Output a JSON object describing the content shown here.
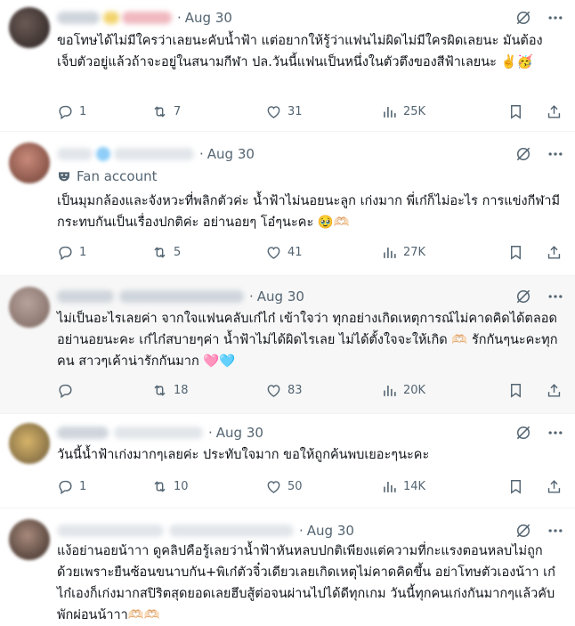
{
  "replies": [
    {
      "date": "Aug 30",
      "label": "",
      "text": "ขอโทษได้ไม่มีใครว่าเลยนะคับน้ำฟ้า แต่อยากให้รู้ว่าแฟนไม่ผิดไม่มีใครผิดเลยนะ มันต้องเจ็บตัวอยู่แล้วถ้าจะอยู่ในสนามกีฬา ปล.วันนี้แฟนเป็นหนึ่งในตัวตึงของสีฟ้าเลยนะ ✌️🥳",
      "stats": {
        "replies": "1",
        "reposts": "7",
        "likes": "31",
        "views": "25K"
      }
    },
    {
      "date": "Aug 30",
      "label": "Fan account",
      "text": "เป็นมุมกล้องและจังหวะที่พลิกตัวค่ะ น้ำฟ้าไม่นอยนะลูก เก่งมาก พี่เก๋ก็ไม่อะไร การแข่งกีฬามีกระทบกันเป็นเรื่องปกติค่ะ อย่านอยๆ โอ๋ๆนะคะ 🥹🫶🏻",
      "stats": {
        "replies": "1",
        "reposts": "5",
        "likes": "41",
        "views": "27K"
      }
    },
    {
      "date": "Aug 30",
      "label": "",
      "text": "ไม่เป็นอะไรเลยค่า จากใจแฟนคลับเก๋ไก๋ เข้าใจว่า ทุกอย่างเกิดเหตุการณ์ไม่คาดคิดได้ตลอด อย่านอยนะคะ เก๋ไก๋สบายๆค่า น้ำฟ้าไม่ได้ผิดไรเลย ไม่ได้ตั้งใจจะให้เกิด 🫶🏻 รักกันๆนะคะทุกคน สาวๆเค้าน่ารักกันมาก 🩷🩵",
      "stats": {
        "replies": "",
        "reposts": "18",
        "likes": "83",
        "views": "20K"
      }
    },
    {
      "date": "Aug 30",
      "label": "",
      "text": "วันนี้น้ำฟ้าเก่งมากๆเลยค่ะ ประทับใจมาก ขอให้ถูกค้นพบเยอะๆนะคะ",
      "stats": {
        "replies": "1",
        "reposts": "10",
        "likes": "50",
        "views": "14K"
      }
    },
    {
      "date": "Aug 30",
      "label": "",
      "text": "แง้อย่านอยน้าาา ดูคลิปคือรู้เลยว่าน้ำฟ้าหันหลบปกติเพียงแต่ความที่กะแรงตอนหลบไม่ถูกด้วยเพราะยืนซ้อนขนาบกัน+พิเก๋ตัวจิ๋วเดียวเลยเกิดเหตุไม่คาดคิดขึ้น อย่าโทษตัวเองน้าา เก๋ไก๋เองก็เก่งมากสปิริตสุดยอดเลยฮึบสู้ต่อจนผ่านไปได้ดีทุกเกม วันนี้ทุกคนเก่งกันมากๆแล้วคับพักผ่อนน้าาา🫶🏻🫶🏻",
      "stats": {
        "replies": "",
        "reposts": "",
        "likes": "",
        "views": ""
      }
    }
  ],
  "colors": {
    "text": "#0f1419",
    "muted": "#536471",
    "shaded_row": "#f7f7f7",
    "divider": "#eff3f4"
  },
  "icons": {
    "reply": "reply-bubble-icon",
    "repost": "repost-icon",
    "like": "heart-icon",
    "views": "views-bars-icon",
    "bookmark": "bookmark-icon",
    "share": "share-upload-icon",
    "grok": "grok-slash-icon",
    "more": "more-dots-icon",
    "fan_badge": "fan-mask-icon"
  }
}
